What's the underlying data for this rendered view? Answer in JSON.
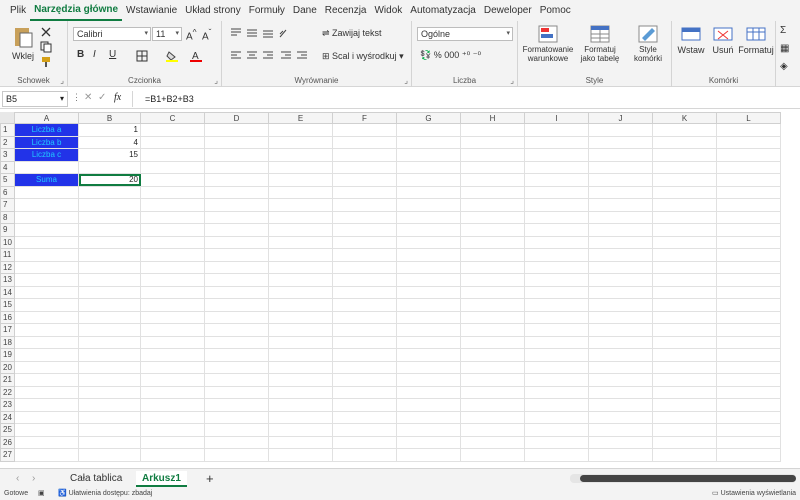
{
  "tabs": [
    "Plik",
    "Narzędzia główne",
    "Wstawianie",
    "Układ strony",
    "Formuły",
    "Dane",
    "Recenzja",
    "Widok",
    "Automatyzacja",
    "Deweloper",
    "Pomoc"
  ],
  "active_tab": "Narzędzia główne",
  "ribbon": {
    "clipboard": {
      "paste": "Wklej",
      "label": "Schowek"
    },
    "font": {
      "name": "Calibri",
      "size": "11",
      "label": "Czcionka",
      "bold": "B",
      "italic": "I",
      "underline": "U"
    },
    "alignment": {
      "wrap": "Zawijaj tekst",
      "merge": "Scal i wyśrodkuj",
      "label": "Wyrównanie"
    },
    "number": {
      "format": "Ogólne",
      "label": "Liczba"
    },
    "styles": {
      "conditional": "Formatowanie warunkowe",
      "table": "Formatuj jako tabelę",
      "cell": "Style komórki",
      "label": "Style"
    },
    "cells": {
      "insert": "Wstaw",
      "delete": "Usuń",
      "format": "Formatuj",
      "label": "Komórki"
    }
  },
  "formula_bar": {
    "name_box": "B5",
    "fx": "fx",
    "formula": "=B1+B2+B3"
  },
  "columns": [
    "A",
    "B",
    "C",
    "D",
    "E",
    "F",
    "G",
    "H",
    "I",
    "J",
    "K",
    "L"
  ],
  "rows": [
    {
      "n": "1",
      "a": "Liczba a",
      "b": "1"
    },
    {
      "n": "2",
      "a": "Liczba b",
      "b": "4"
    },
    {
      "n": "3",
      "a": "Liczba c",
      "b": "15"
    },
    {
      "n": "4",
      "a": "",
      "b": ""
    },
    {
      "n": "5",
      "a": "Suma",
      "b": "20"
    }
  ],
  "row_count": 27,
  "sheet_tabs": [
    "Cała tablica",
    "Arkusz1"
  ],
  "active_sheet": "Arkusz1",
  "add_sheet": "+",
  "status": {
    "left": "Gotowe",
    "accessibility": "Ułatwienia dostępu: zbadaj",
    "right": "Ustawienia wyświetlania"
  },
  "colors": {
    "accent": "#107c41",
    "cell_fill": "#2233e8",
    "cell_text": "#20c8ff"
  }
}
